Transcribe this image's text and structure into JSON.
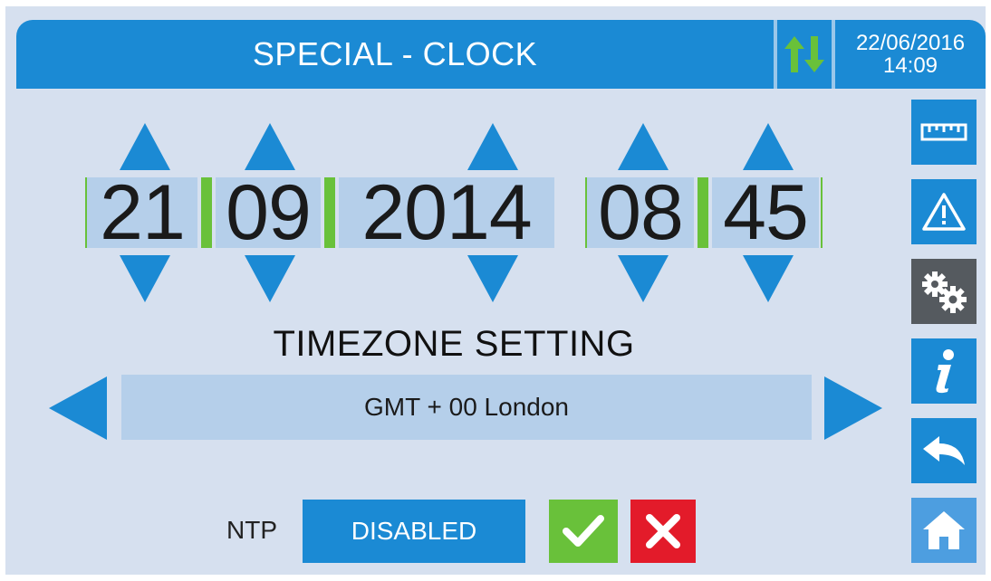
{
  "header": {
    "title": "SPECIAL - CLOCK",
    "date": "22/06/2016",
    "time": "14:09"
  },
  "clock": {
    "day": "21",
    "month": "09",
    "year": "2014",
    "hour": "08",
    "minute": "45"
  },
  "timezone": {
    "title": "TIMEZONE SETTING",
    "value": "GMT + 00 London"
  },
  "ntp": {
    "label": "NTP",
    "state": "DISABLED"
  },
  "sidebar": {
    "items": [
      {
        "icon": "ruler-icon"
      },
      {
        "icon": "warning-icon"
      },
      {
        "icon": "gears-icon"
      },
      {
        "icon": "info-icon"
      },
      {
        "icon": "back-icon"
      },
      {
        "icon": "home-icon"
      }
    ]
  },
  "colors": {
    "primary_blue": "#1b8ad4",
    "background": "#d6e0ef",
    "field": "#b5cfea",
    "green": "#69c13a",
    "red": "#e31b2a",
    "dark_gray": "#555a5f"
  }
}
